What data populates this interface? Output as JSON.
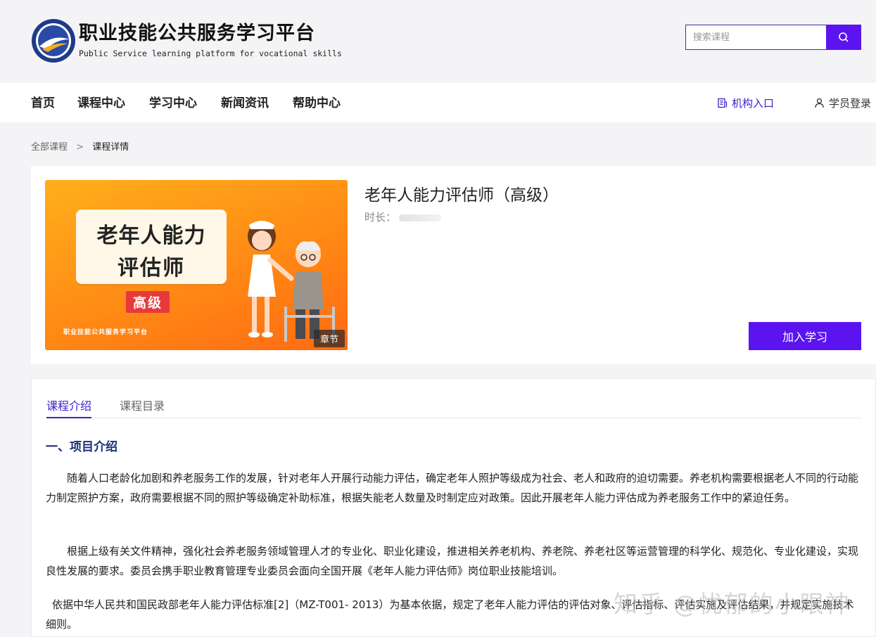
{
  "brand": {
    "title_cn": "职业技能公共服务学习平台",
    "title_en": "Public Service learning platform for vocational skills"
  },
  "search": {
    "placeholder": "搜索课程"
  },
  "nav": {
    "items": [
      "首页",
      "课程中心",
      "学习中心",
      "新闻资讯",
      "帮助中心"
    ],
    "org_entry": "机构入口",
    "student_login": "学员登录"
  },
  "breadcrumb": {
    "root": "全部课程",
    "separator": ">",
    "current": "课程详情"
  },
  "course": {
    "title": "老年人能力评估师（高级）",
    "duration_label": "时长：",
    "join_button": "加入学习",
    "cover": {
      "line1": "老年人能力",
      "line2": "评估师",
      "level": "高级",
      "brand": "职业技能公共服务学习平台",
      "tag": "章节"
    }
  },
  "tabs": [
    "课程介绍",
    "课程目录"
  ],
  "content": {
    "section_title": "一、项目介绍",
    "paragraphs": [
      "随着人口老龄化加剧和养老服务工作的发展，针对老年人开展行动能力评估，确定老年人照护等级成为社会、老人和政府的迫切需要。养老机构需要根据老人不同的行动能力制定照护方案，政府需要根据不同的照护等级确定补助标准，根据失能老人数量及时制定应对政策。因此开展老年人能力评估成为养老服务工作中的紧迫任务。",
      "根据上级有关文件精神，强化社会养老服务领域管理人才的专业化、职业化建设，推进相关养老机构、养老院、养老社区等运营管理的科学化、规范化、专业化建设，实现良性发展的要求。委员会携手职业教育管理专业委员会面向全国开展《老年人能力评估师》岗位职业技能培训。",
      "依据中华人民共和国民政部老年人能力评估标准[2]（MZ-T001- 2013）为基本依据，规定了老年人能力评估的评估对象、评估指标、评估实施及评估结果，并规定实施技术细则。"
    ]
  },
  "watermark": "知乎 @忧郁的小眼神",
  "colors": {
    "accent": "#5b14f0",
    "nav_accent": "#3a22c8",
    "heading": "#1b2f7a"
  }
}
